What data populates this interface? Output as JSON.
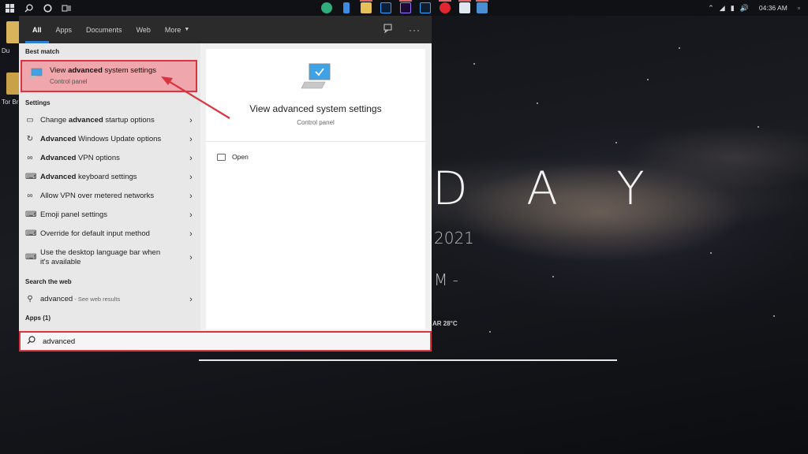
{
  "taskbar": {
    "icons": [
      "windows-start-icon",
      "search-icon",
      "cortana-icon",
      "task-view-icon"
    ],
    "apps": [
      "edge",
      "file-explorer",
      "folder",
      "photoshop",
      "premiere-pro",
      "lightroom-classic",
      "opera",
      "sublime",
      "steam"
    ],
    "time": "04:36 AM"
  },
  "desktop": {
    "icon1_label": "Du",
    "icon2_label": "Tor Br",
    "big_text": "D A Y",
    "year_text": "2021",
    "time_text": "M -",
    "weather_text": "AR 28°C"
  },
  "menu": {
    "tabs": [
      {
        "label": "All",
        "active": true
      },
      {
        "label": "Apps"
      },
      {
        "label": "Documents"
      },
      {
        "label": "Web"
      },
      {
        "label": "More"
      }
    ],
    "best_match_heading": "Best match",
    "best_match": {
      "title_pre": "View ",
      "title_bold": "advanced",
      "title_post": " system settings",
      "subtitle": "Control panel"
    },
    "settings_heading": "Settings",
    "settings_items": [
      {
        "pre": "Change ",
        "bold": "advanced",
        "post": " startup options",
        "icon": "monitor-icon"
      },
      {
        "pre": "",
        "bold": "Advanced",
        "post": " Windows Update options",
        "icon": "sync-icon"
      },
      {
        "pre": "",
        "bold": "Advanced",
        "post": " VPN options",
        "icon": "vpn-icon"
      },
      {
        "pre": "",
        "bold": "Advanced",
        "post": " keyboard settings",
        "icon": "keyboard-icon"
      },
      {
        "pre": "Allow VPN over metered networks",
        "bold": "",
        "post": "",
        "icon": "vpn-icon"
      },
      {
        "pre": "Emoji panel settings",
        "bold": "",
        "post": "",
        "icon": "keyboard-icon"
      },
      {
        "pre": "Override for default input method",
        "bold": "",
        "post": "",
        "icon": "keyboard-icon"
      },
      {
        "pre": "Use the desktop language bar when it's available",
        "bold": "",
        "post": "",
        "icon": "keyboard-icon"
      }
    ],
    "web_heading": "Search the web",
    "web_item": {
      "term": "advanced",
      "note": " - See web results"
    },
    "apps_heading": "Apps (1)",
    "preview": {
      "title": "View advanced system settings",
      "subtitle": "Control panel",
      "open_label": "Open"
    },
    "search": {
      "value": "advanced"
    }
  },
  "colors": {
    "highlight": "#efa7ad",
    "annotation_red": "#d9343f",
    "accent": "#2d7fd6"
  }
}
